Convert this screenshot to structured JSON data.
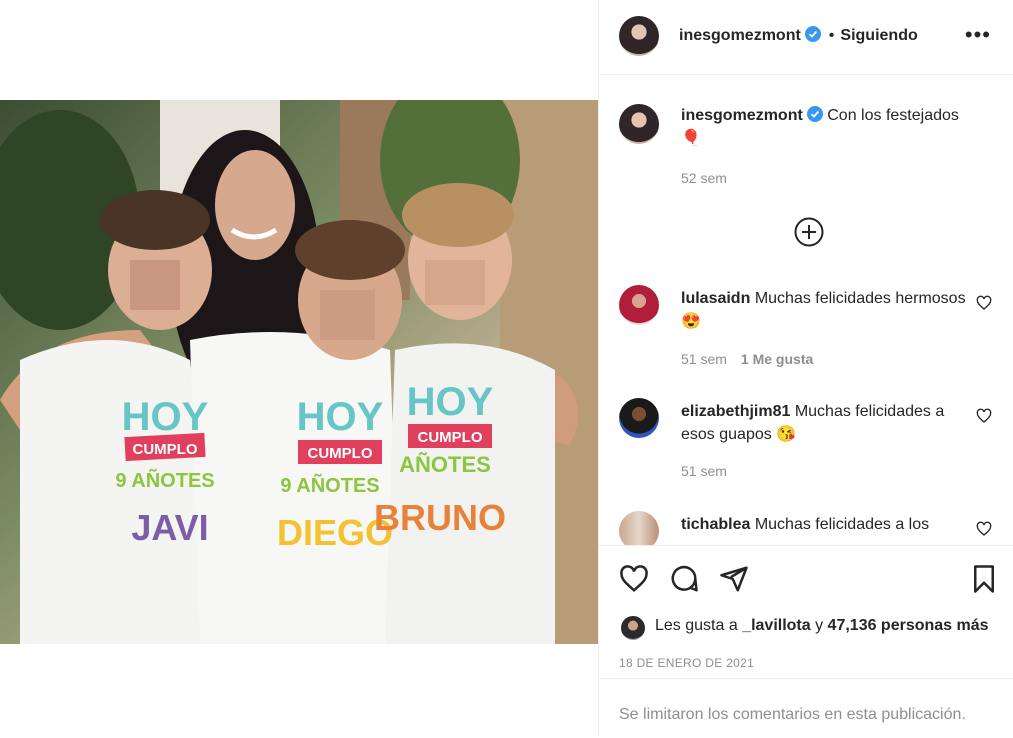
{
  "post": {
    "username": "inesgomezmont",
    "follow_status": "Siguiendo",
    "separator": "•",
    "more_label": "•••",
    "caption": "Con los festejados",
    "caption_emoji": "🎈",
    "caption_time": "52 sem",
    "shirts": [
      "JAVI",
      "DIEGO",
      "BRUNO"
    ],
    "shirt_line1": "HOY",
    "shirt_line2": "CUMPLO",
    "shirt_line3": "9 AÑOTES"
  },
  "comments": [
    {
      "username": "lulasaidn",
      "text": "Muchas felicidades hermosos 😍",
      "time": "51 sem",
      "likes": "1 Me gusta"
    },
    {
      "username": "elizabethjim81",
      "text": "Muchas felicidades a esos guapos 😘",
      "time": "51 sem",
      "likes": ""
    },
    {
      "username": "tichablea",
      "text": "Muchas felicidades a los",
      "time": "",
      "likes": ""
    }
  ],
  "likes": {
    "prefix": "Les gusta a ",
    "user": "_lavillota",
    "middle": " y ",
    "count": "47,136 personas más"
  },
  "date": "18 DE ENERO DE 2021",
  "footer": "Se limitaron los comentarios en esta publicación.",
  "colors": {
    "verified": "#3897f0",
    "text": "#262626",
    "muted": "#8e8e8e"
  }
}
